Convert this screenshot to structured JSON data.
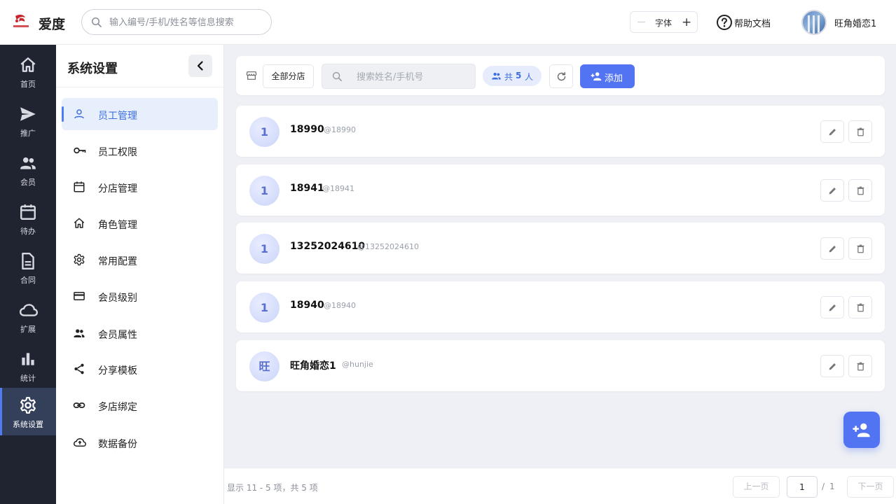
{
  "header": {
    "app_name": "爱度",
    "search_placeholder": "输入编号/手机/姓名等信息搜索",
    "font_label": "字体",
    "font_minus": "—",
    "font_plus": "+",
    "help_label": "帮助文档",
    "username": "旺角婚恋1"
  },
  "nav": {
    "items": [
      {
        "label": "首页",
        "icon": "home-icon"
      },
      {
        "label": "推广",
        "icon": "send-icon"
      },
      {
        "label": "会员",
        "icon": "people-icon"
      },
      {
        "label": "待办",
        "icon": "calendar-icon"
      },
      {
        "label": "合同",
        "icon": "document-icon"
      },
      {
        "label": "扩展",
        "icon": "cloud-icon"
      },
      {
        "label": "统计",
        "icon": "bar-chart-icon"
      },
      {
        "label": "系统设置",
        "icon": "gear-icon"
      }
    ],
    "active_index": 7
  },
  "submenu": {
    "title": "系统设置",
    "items": [
      {
        "label": "员工管理",
        "icon": "person-icon"
      },
      {
        "label": "员工权限",
        "icon": "key-icon"
      },
      {
        "label": "分店管理",
        "icon": "calendar-icon"
      },
      {
        "label": "角色管理",
        "icon": "home-icon"
      },
      {
        "label": "常用配置",
        "icon": "gear-icon"
      },
      {
        "label": "会员级别",
        "icon": "card-icon"
      },
      {
        "label": "会员属性",
        "icon": "people-icon"
      },
      {
        "label": "分享模板",
        "icon": "share-icon"
      },
      {
        "label": "多店绑定",
        "icon": "link-icon"
      },
      {
        "label": "数据备份",
        "icon": "cloud-upload-icon"
      }
    ],
    "active_index": 0
  },
  "toolbar": {
    "store_label": "全部分店",
    "search_placeholder": "搜索姓名/手机号",
    "count_prefix": "共",
    "count": "5",
    "count_suffix": "人",
    "add_label": "添加"
  },
  "employees": [
    {
      "avatar": "1",
      "name": "18990",
      "handle": "@18990"
    },
    {
      "avatar": "1",
      "name": "18941",
      "handle": "@18941"
    },
    {
      "avatar": "1",
      "name": "13252024610",
      "handle": "@13252024610"
    },
    {
      "avatar": "1",
      "name": "18940",
      "handle": "@18940"
    },
    {
      "avatar": "旺",
      "name": "旺角婚恋1",
      "handle": "@hunjie"
    }
  ],
  "footer": {
    "range_text": "显示 11 - 5 项，共 5 项",
    "prev_label": "上一页",
    "page_value": "1",
    "page_separator": "/",
    "page_total": "1",
    "next_label": "下一页"
  },
  "colors": {
    "accent": "#5273f2",
    "nav_bg": "#1f2430",
    "nav_active": "#34405a",
    "menu_active_bg": "#e8effc"
  }
}
